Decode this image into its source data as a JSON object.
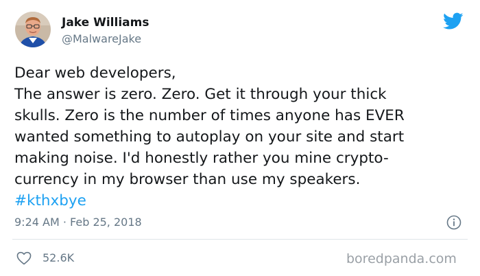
{
  "author": {
    "name": "Jake Williams",
    "handle": "@MalwareJake"
  },
  "tweet": {
    "lines": [
      "Dear web developers,",
      "The answer is zero. Zero. Get it through your thick",
      "skulls. Zero is the number of times anyone has EVER",
      "wanted something to autoplay on your site and start",
      "making noise. I'd honestly rather you mine crypto-",
      "currency in my browser than use my speakers."
    ],
    "hashtag": "#kthxbye"
  },
  "meta": {
    "timestamp": "9:24 AM · Feb 25, 2018",
    "likes": "52.6K"
  },
  "watermark": "boredpanda.com",
  "colors": {
    "brand": "#1da1f2",
    "text": "#14171a",
    "muted": "#657786"
  },
  "icons": {
    "brand": "twitter-bird-icon",
    "info": "info-icon",
    "like": "heart-icon"
  }
}
